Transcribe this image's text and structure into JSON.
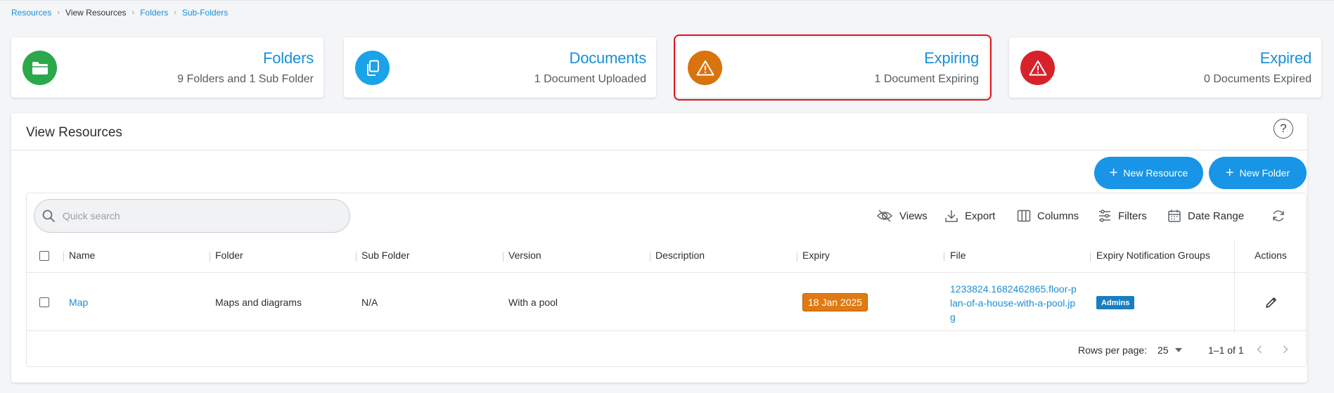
{
  "breadcrumb": [
    {
      "label": "Resources",
      "link": true
    },
    {
      "label": "View Resources",
      "link": false
    },
    {
      "label": "Folders",
      "link": true
    },
    {
      "label": "Sub-Folders",
      "link": true
    }
  ],
  "cards": [
    {
      "title": "Folders",
      "subtitle": "9 Folders and 1 Sub Folder",
      "icon": "folder-icon",
      "color": "#2ba84a"
    },
    {
      "title": "Documents",
      "subtitle": "1 Document Uploaded",
      "icon": "documents-icon",
      "color": "#1aa3e8"
    },
    {
      "title": "Expiring",
      "subtitle": "1 Document Expiring",
      "icon": "warning-icon",
      "color": "#d9730d"
    },
    {
      "title": "Expired",
      "subtitle": "0 Documents Expired",
      "icon": "warning-icon",
      "color": "#d8222b"
    }
  ],
  "panel": {
    "title": "View Resources",
    "help_label": "?",
    "new_resource_label": "New Resource",
    "new_folder_label": "New Folder"
  },
  "grid": {
    "search_placeholder": "Quick search",
    "toolbar": {
      "views": "Views",
      "export": "Export",
      "columns": "Columns",
      "filters": "Filters",
      "date_range": "Date Range"
    },
    "columns": [
      "Name",
      "Folder",
      "Sub Folder",
      "Version",
      "Description",
      "Expiry",
      "File",
      "Expiry Notification Groups",
      "Actions"
    ],
    "rows": [
      {
        "name": "Map",
        "folder": "Maps and diagrams",
        "sub_folder": "N/A",
        "version": "With a pool",
        "description": "",
        "expiry": "18 Jan 2025",
        "file": "1233824.1682462865.floor-plan-of-a-house-with-a-pool.jpg",
        "groups": "Admins"
      }
    ],
    "footer": {
      "rows_per_page_label": "Rows per page:",
      "rows_per_page": "25",
      "page_info": "1–1 of 1"
    }
  },
  "colors": {
    "accent": "#1895e6",
    "highlight_border": "#e0141e",
    "expiry_badge": "#e07a12",
    "group_badge": "#1a7fc1"
  }
}
